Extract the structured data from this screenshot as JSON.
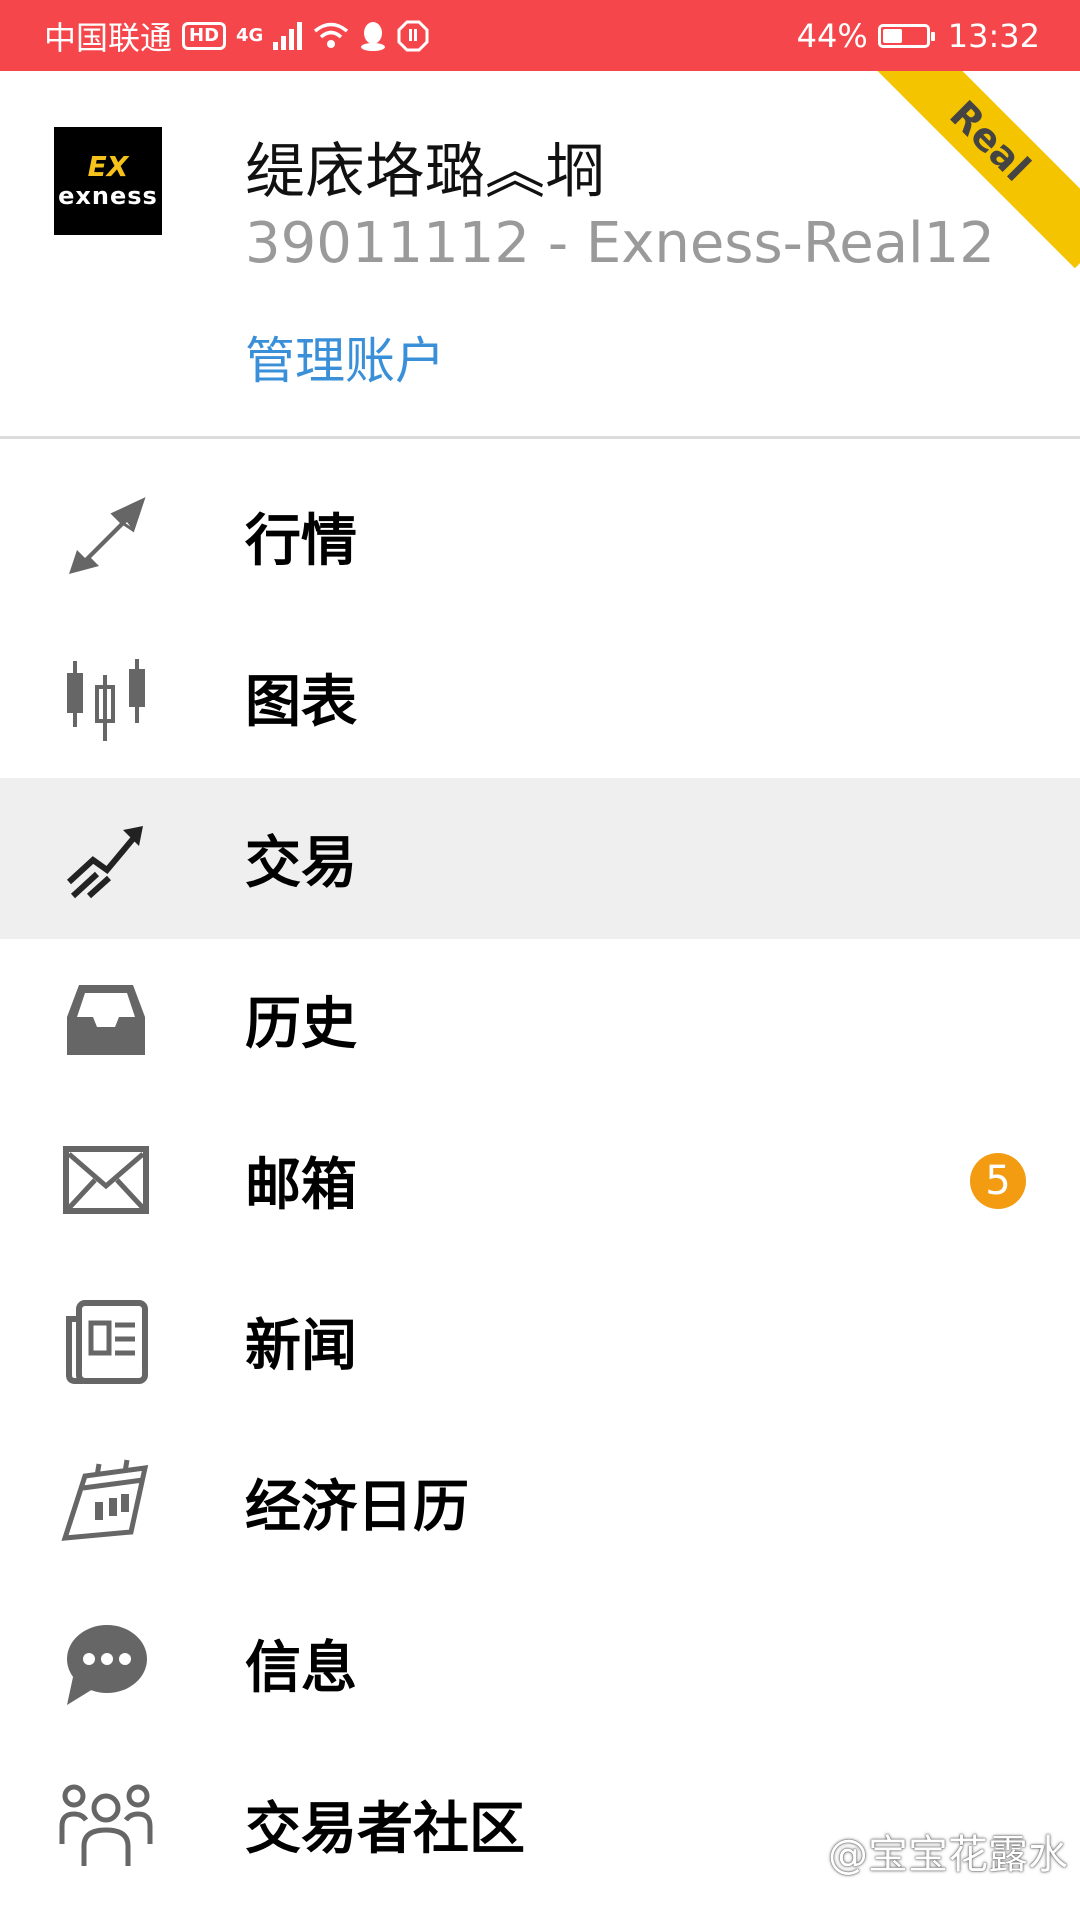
{
  "status_bar": {
    "carrier": "中国联通",
    "hd": "HD",
    "network": "4G",
    "battery": "44%",
    "battery_level": 0.44,
    "time": "13:32"
  },
  "account": {
    "logo_mark": "EX",
    "logo_text": "exness",
    "name": "缇庡垎璐︽埛",
    "number": "39011112 - Exness-Real12",
    "manage_link": "管理账户",
    "ribbon": "Real"
  },
  "menu": [
    {
      "label": "行情",
      "icon": "arrows-expand-icon"
    },
    {
      "label": "图表",
      "icon": "candlestick-icon"
    },
    {
      "label": "交易",
      "icon": "trend-up-icon",
      "selected": true
    },
    {
      "label": "历史",
      "icon": "inbox-icon"
    },
    {
      "label": "邮箱",
      "icon": "envelope-icon",
      "badge": "5"
    },
    {
      "label": "新闻",
      "icon": "newspaper-icon"
    },
    {
      "label": "经济日历",
      "icon": "calendar-icon"
    },
    {
      "label": "信息",
      "icon": "chat-icon"
    },
    {
      "label": "交易者社区",
      "icon": "community-icon"
    }
  ],
  "watermark": "@宝宝花露水",
  "colors": {
    "status_bar": "#f5474b",
    "link": "#3a8fd9",
    "ribbon": "#f5c400",
    "badge": "#f39c12",
    "selected_row": "#efefef"
  }
}
